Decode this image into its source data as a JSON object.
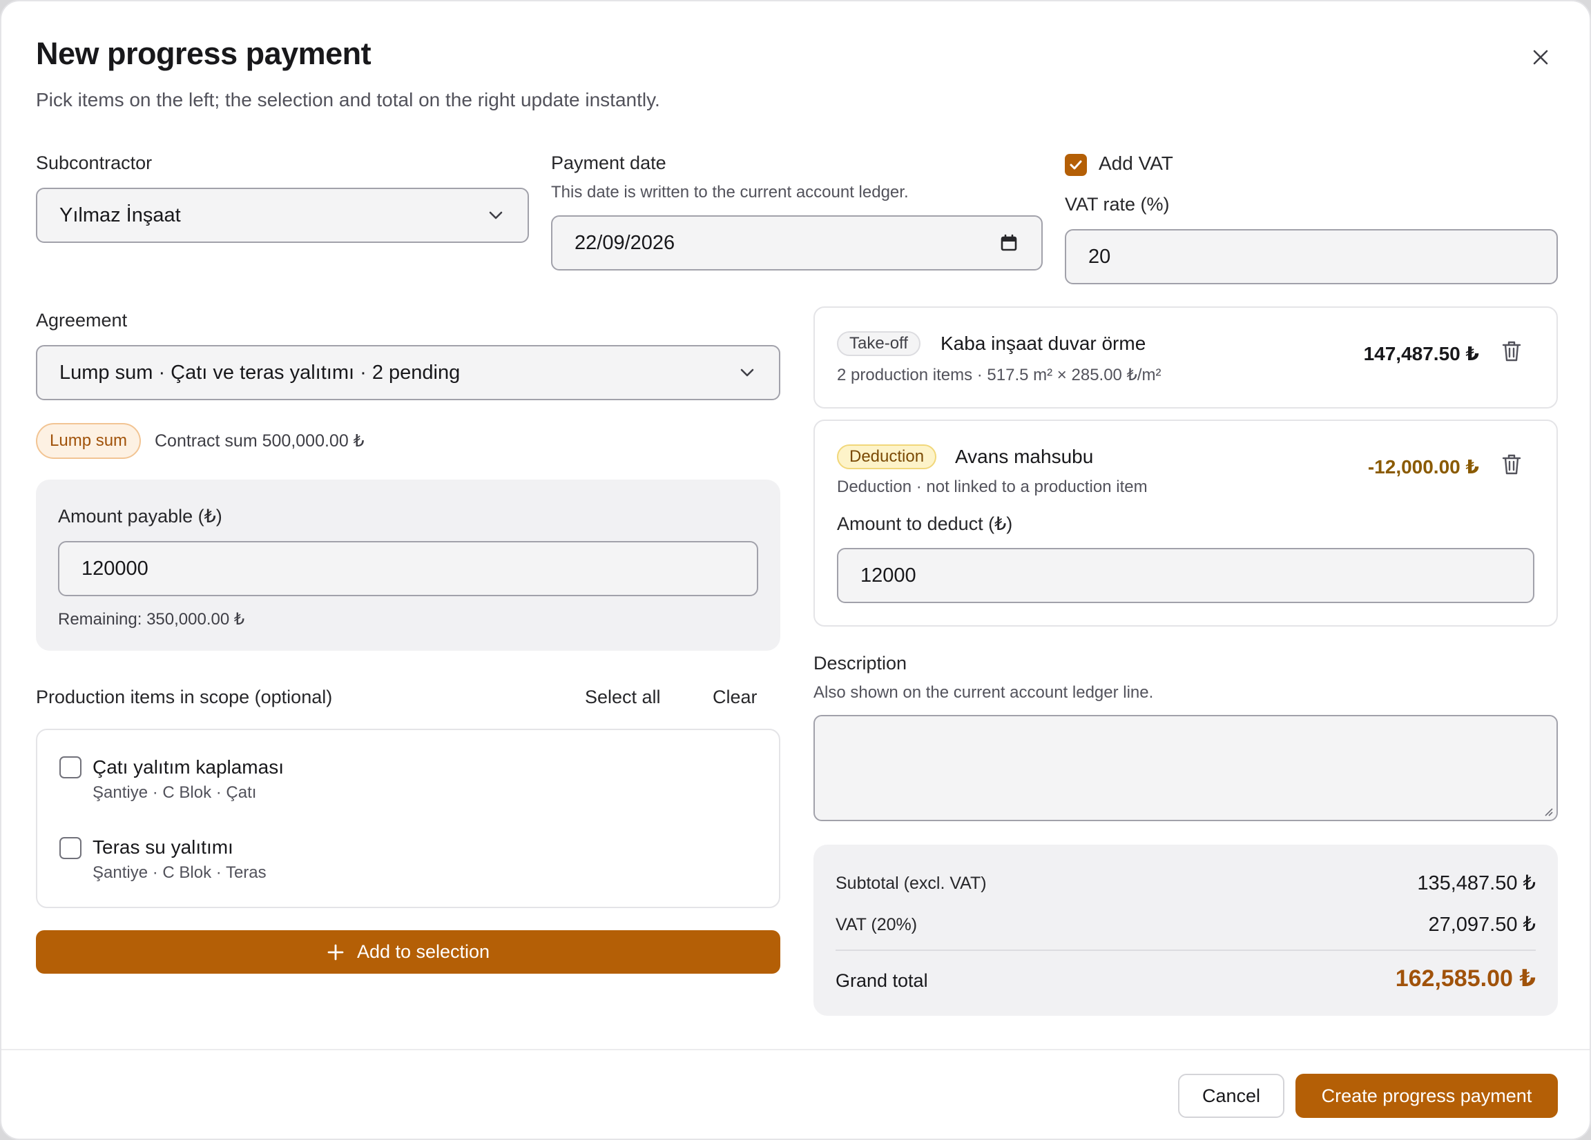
{
  "dialog": {
    "title": "New progress payment",
    "subtitle": "Pick items on the left; the selection and total on the right update instantly.",
    "close_icon": "close-icon"
  },
  "subcontractor": {
    "label": "Subcontractor",
    "value": "Yılmaz İnşaat"
  },
  "payment_date": {
    "label": "Payment date",
    "hint": "This date is written to the current account ledger.",
    "value": "22/09/2026"
  },
  "vat": {
    "add_label": "Add VAT",
    "checked": true,
    "rate_label": "VAT rate (%)",
    "rate_value": "20"
  },
  "agreement": {
    "label": "Agreement",
    "value": "Lump sum · Çatı ve teras yalıtımı · 2 pending",
    "badge": "Lump sum",
    "contract_sum": "Contract sum 500,000.00 ₺"
  },
  "amount_payable": {
    "label": "Amount payable (₺)",
    "value": "120000",
    "remaining": "Remaining: 350,000.00 ₺"
  },
  "production_items": {
    "header": "Production items in scope (optional)",
    "select_all": "Select all",
    "clear": "Clear",
    "items": [
      {
        "title": "Çatı yalıtım kaplaması",
        "subtitle": "Şantiye · C Blok · Çatı",
        "checked": false
      },
      {
        "title": "Teras su yalıtımı",
        "subtitle": "Şantiye · C Blok · Teras",
        "checked": false
      }
    ],
    "add_button": "Add to selection"
  },
  "selection": {
    "takeoff": {
      "tag": "Take-off",
      "title": "Kaba inşaat duvar örme",
      "detail": "2 production items · 517.5 m² × 285.00 ₺/m²",
      "amount": "147,487.50 ₺"
    },
    "deduction": {
      "tag": "Deduction",
      "title": "Avans mahsubu",
      "detail": "Deduction · not linked to a production item",
      "amount": "-12,000.00 ₺",
      "amount_color": "#8a5a00",
      "input_label": "Amount to deduct (₺)",
      "input_value": "12000"
    }
  },
  "description": {
    "label": "Description",
    "hint": "Also shown on the current account ledger line.",
    "value": ""
  },
  "summary": {
    "subtotal_label": "Subtotal (excl. VAT)",
    "subtotal_value": "135,487.50 ₺",
    "vat_label": "VAT (20%)",
    "vat_value": "27,097.50 ₺",
    "grand_label": "Grand total",
    "grand_value": "162,585.00 ₺",
    "grand_color": "#a0520a"
  },
  "footer": {
    "cancel": "Cancel",
    "submit": "Create progress payment"
  },
  "colors": {
    "accent": "#b45f06"
  }
}
